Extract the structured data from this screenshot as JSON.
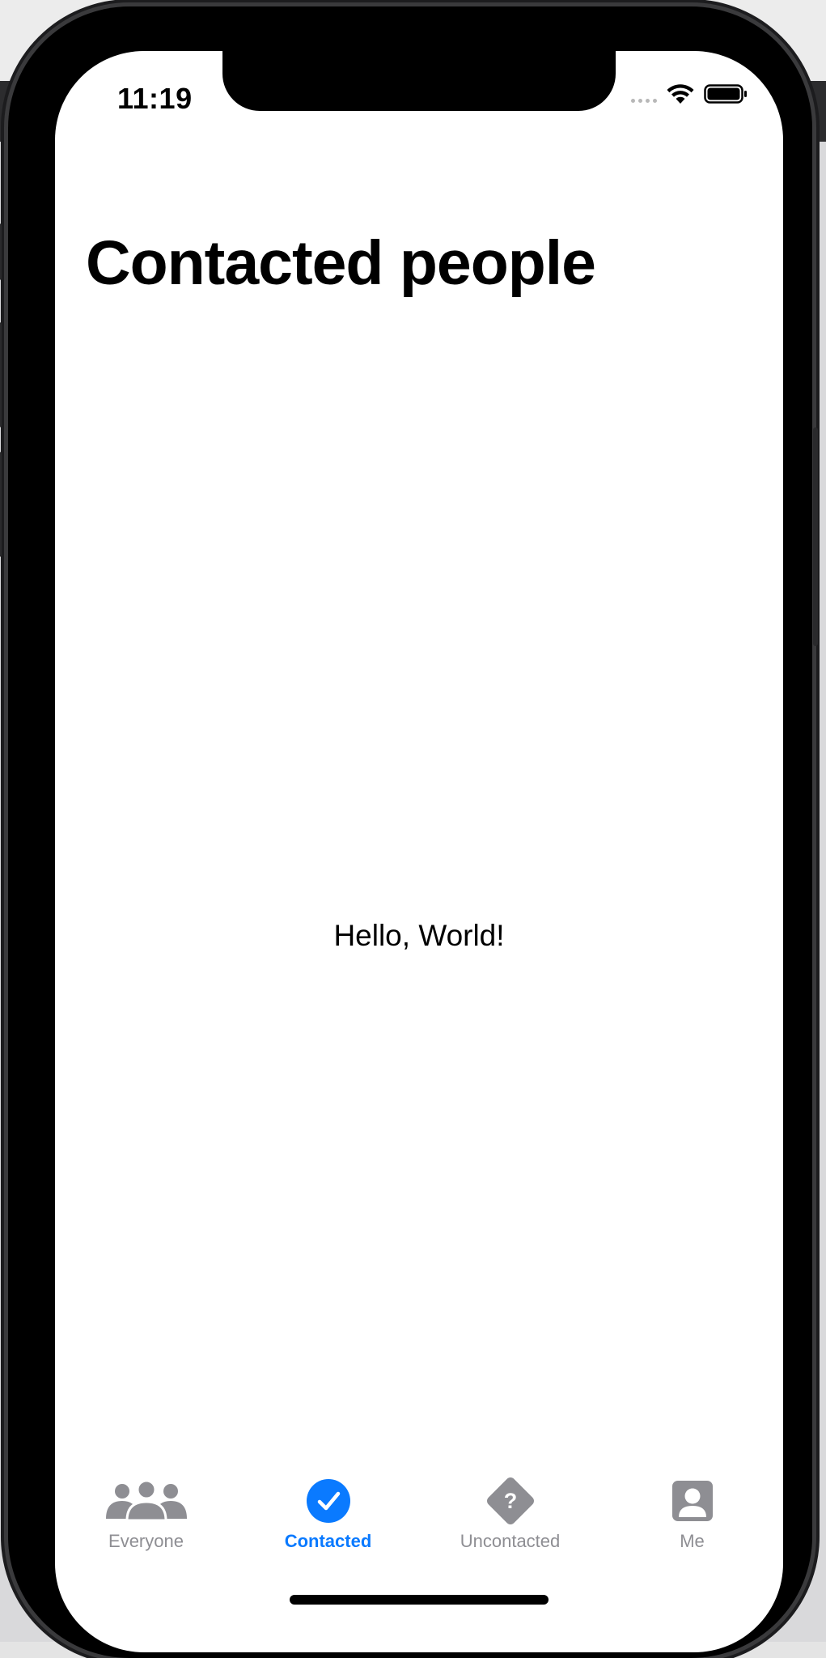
{
  "status_bar": {
    "time": "11:19"
  },
  "screen": {
    "title": "Contacted people",
    "content_text": "Hello, World!"
  },
  "tab_bar": {
    "tabs": [
      {
        "label": "Everyone",
        "icon": "person-3-icon",
        "active": false
      },
      {
        "label": "Contacted",
        "icon": "checkmark-circle-icon",
        "active": true
      },
      {
        "label": "Uncontacted",
        "icon": "questionmark-diamond-icon",
        "active": false
      },
      {
        "label": "Me",
        "icon": "person-crop-square-icon",
        "active": false
      }
    ]
  },
  "colors": {
    "accent": "#0a7aff",
    "inactive": "#8e8e93",
    "background": "#ffffff"
  }
}
